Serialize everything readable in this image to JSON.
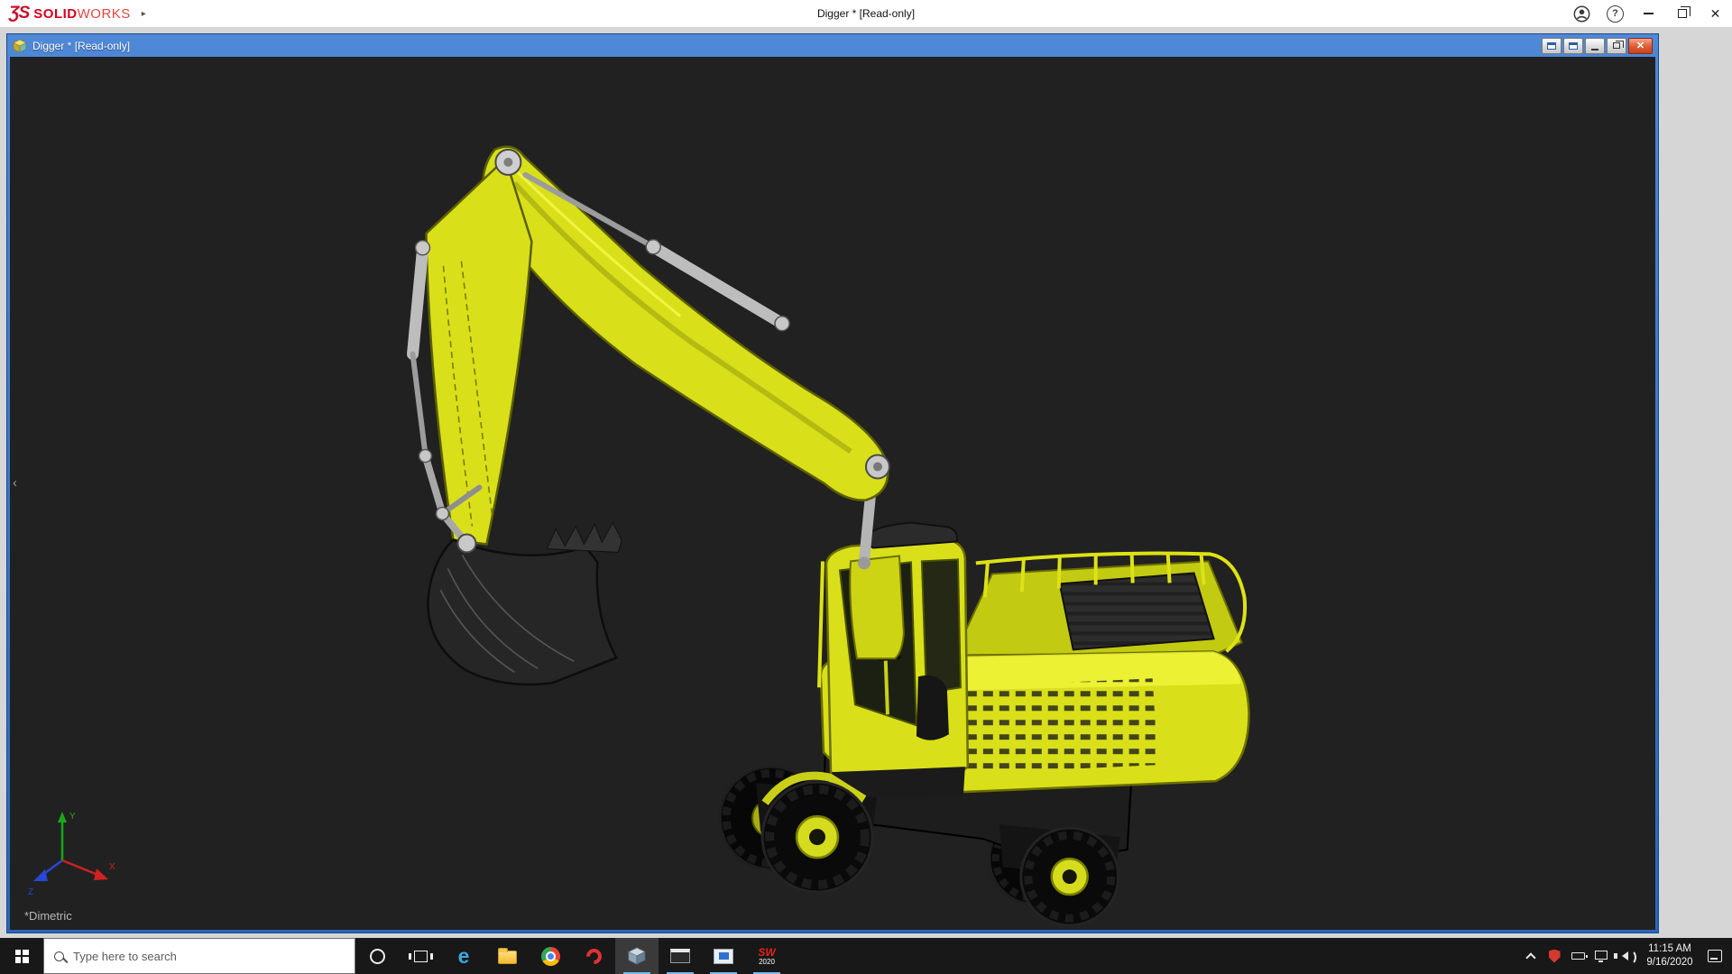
{
  "colors": {
    "solidworks_red": "#d6001c",
    "doc_titlebar_blue": "#2a66b8",
    "viewport_background": "#212121",
    "digger_yellow": "#d9e01a",
    "taskbar_background": "#181818",
    "taskbar_accent_underline": "#76b9ed",
    "doc_close_red": "#df5a32"
  },
  "app": {
    "brand_mark": "ƷS",
    "brand_solid": "SOLID",
    "brand_works": "WORKS",
    "flyout_arrow": "▸",
    "title": "Digger * [Read-only]",
    "help_glyph": "?",
    "close_glyph": "✕"
  },
  "document": {
    "title": "Digger * [Read-only]",
    "close_glyph": "✕",
    "view_label": "*Dimetric",
    "collapse_chevron": "‹",
    "triad": {
      "x": "X",
      "y": "Y",
      "z": "Z"
    }
  },
  "taskbar": {
    "search_placeholder": "Type here to search",
    "sw_app_letters": "SW",
    "sw_app_year": "2020",
    "clock_time": "11:15 AM",
    "clock_date": "9/16/2020"
  },
  "icons": {
    "edge_letter": "e",
    "start": "windows-grid",
    "cortana": "circle-ring",
    "task_view": "filmstrip",
    "file_explorer": "folder",
    "chrome": "color-wheel",
    "adobe_reader": "red-swirl",
    "cad_part": "cube",
    "console": "terminal-window",
    "blue_app": "blue-window",
    "tray_chevron": "chevron-up",
    "security": "shield",
    "power": "battery",
    "network": "monitor",
    "volume": "speaker",
    "action_center": "chat-square"
  }
}
